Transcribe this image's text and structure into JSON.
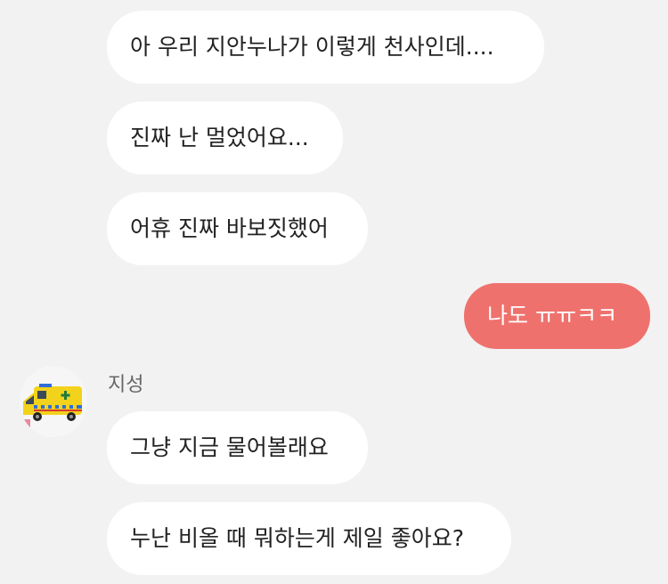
{
  "chat": {
    "messages": [
      {
        "direction": "incoming",
        "text": "아 우리 지안누나가 이렇게 천사인데...."
      },
      {
        "direction": "incoming",
        "text": "진짜 난 멀었어요..."
      },
      {
        "direction": "incoming",
        "text": "어휴 진짜 바보짓했어"
      },
      {
        "direction": "outgoing",
        "text": "나도 ㅠㅠㅋㅋ"
      },
      {
        "direction": "incoming",
        "text": "그냥 지금 물어볼래요"
      },
      {
        "direction": "incoming",
        "text": "누난 비올 때 뭐하는게 제일 좋아요?"
      }
    ],
    "sender": {
      "name": "지성",
      "avatar_icon": "ambulance-avatar-icon"
    }
  },
  "colors": {
    "background": "#f2f2f2",
    "incoming_bubble": "#ffffff",
    "outgoing_bubble": "#ef716d",
    "text": "#222222",
    "sender_name": "#666666"
  }
}
